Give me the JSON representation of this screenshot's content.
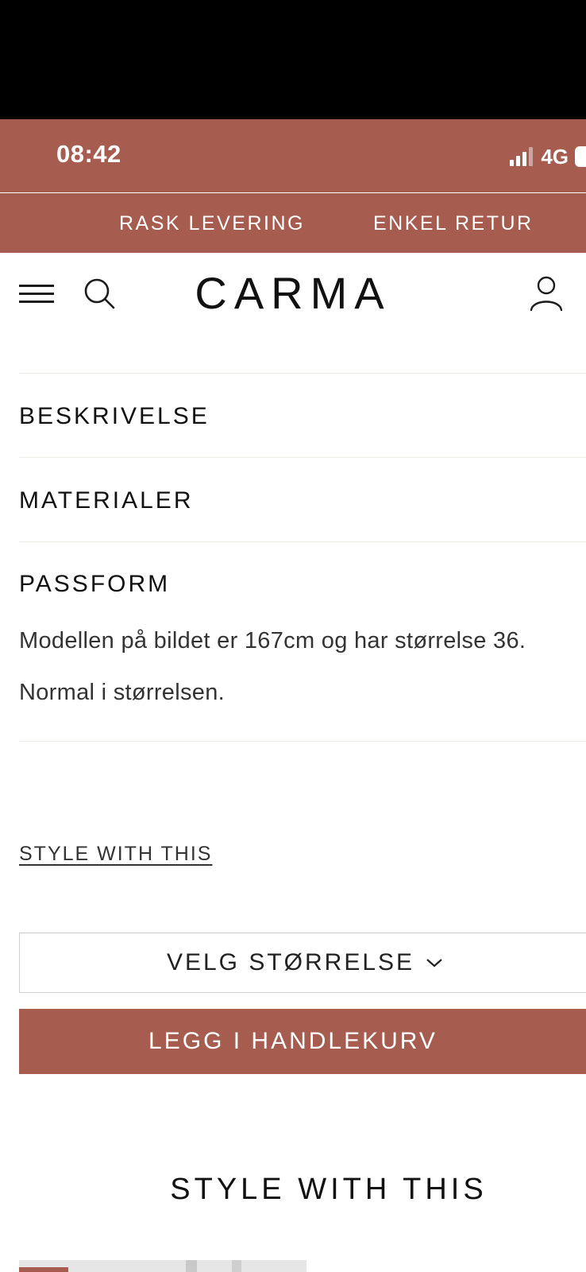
{
  "status_bar": {
    "time": "08:42",
    "network": "4G"
  },
  "promo": {
    "item1": "RASK LEVERING",
    "item2": "ENKEL RETUR"
  },
  "header": {
    "logo": "CARMA",
    "icons": [
      "menu-icon",
      "search-icon",
      "account-icon"
    ]
  },
  "accordion": {
    "items": [
      {
        "title": "BESKRIVELSE"
      },
      {
        "title": "MATERIALER"
      },
      {
        "title": "PASSFORM",
        "body": [
          "Modellen på bildet er 167cm og har størrelse 36.",
          "Normal i størrelsen."
        ]
      }
    ]
  },
  "style_link": "STYLE WITH THIS",
  "size_select": {
    "label": "VELG STØRRELSE"
  },
  "cart_button": "LEGG I HANDLEKURV",
  "section_title": "STYLE WITH THIS",
  "colors": {
    "brand": "#a65c4e",
    "text": "#1c1c1c"
  }
}
